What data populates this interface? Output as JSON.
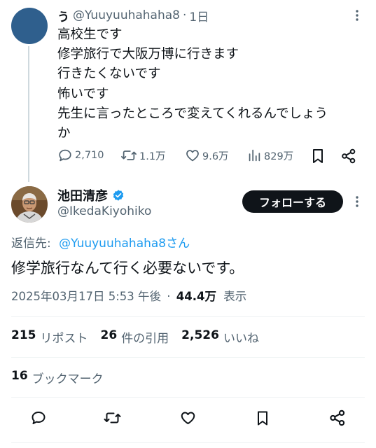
{
  "parent": {
    "name": "う",
    "handle": "@Yuuyuuhahaha8",
    "sep": "·",
    "time": "1日",
    "lines": [
      "高校生です",
      "修学旅行で大阪万博に行きます",
      "行きたくないです",
      "怖いです",
      "先生に言ったところで変えてくれるんでしょう",
      "か"
    ],
    "stats": {
      "replies": "2,710",
      "reposts": "1.1万",
      "likes": "9.6万",
      "views": "829万"
    },
    "avatar_color": "#2f5f8d"
  },
  "main": {
    "author_name": "池田清彦",
    "author_handle": "@IkedaKiyohiko",
    "follow_label": "フォローする",
    "reply_prefix": "返信先:",
    "reply_target": "@Yuuyuuhahaha8さん",
    "text": "修学旅行なんて行く必要ないです。",
    "timestamp": "2025年03月17日 5:53 午後",
    "sep": "·",
    "views": "44.4万",
    "views_label": "表示",
    "reposts": "215",
    "reposts_label": "リポスト",
    "quotes": "26",
    "quotes_label": "件の引用",
    "likes": "2,526",
    "likes_label": "いいね",
    "bookmarks": "16",
    "bookmarks_label": "ブックマーク"
  },
  "colors": {
    "accent": "#1d9bf0",
    "text": "#0f1419",
    "muted": "#536471",
    "divider": "#eff3f4"
  },
  "icons": [
    "more-icon",
    "reply-icon",
    "repost-icon",
    "like-icon",
    "views-icon",
    "bookmark-icon",
    "share-icon",
    "verified-icon"
  ]
}
